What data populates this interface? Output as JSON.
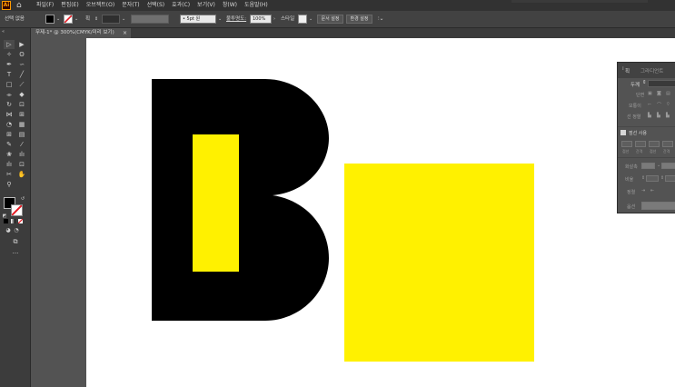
{
  "app": {
    "logo": "Ai",
    "home_icon": "home-icon"
  },
  "menu": [
    "파일(F)",
    "편집(E)",
    "오브젝트(O)",
    "문자(T)",
    "선택(S)",
    "효과(C)",
    "보기(V)",
    "창(W)",
    "도움말(H)"
  ],
  "control_bar": {
    "selection_label": "선택 없음",
    "fill_color": "#000000",
    "stroke_label": "획",
    "brush_label": "5pt 원",
    "opacity_label": "불투명도:",
    "opacity_value": "100%",
    "style_label": "스타일",
    "doc_setup_button": "문서 설정",
    "prefs_button": "환경 설정"
  },
  "document_tab": {
    "label": "무제-1* @ 300%(CMYK/미리 보기)",
    "close": "×"
  },
  "panel": {
    "tabs": [
      "획",
      "그라디언트"
    ],
    "weight_label": "두께",
    "cap_label": "단면",
    "corner_label": "모퉁이",
    "align_label": "선 정렬",
    "dashed_label": "점선 사용",
    "dash_labels": [
      "점선",
      "간격",
      "점선",
      "간격"
    ],
    "arrow_label": "화살촉",
    "scale_label": "비율",
    "align2_label": "정렬",
    "profile_label": "옵션"
  },
  "colors": {
    "yellow": "#FFF100",
    "black": "#000000",
    "ui_bg": "#535353"
  }
}
